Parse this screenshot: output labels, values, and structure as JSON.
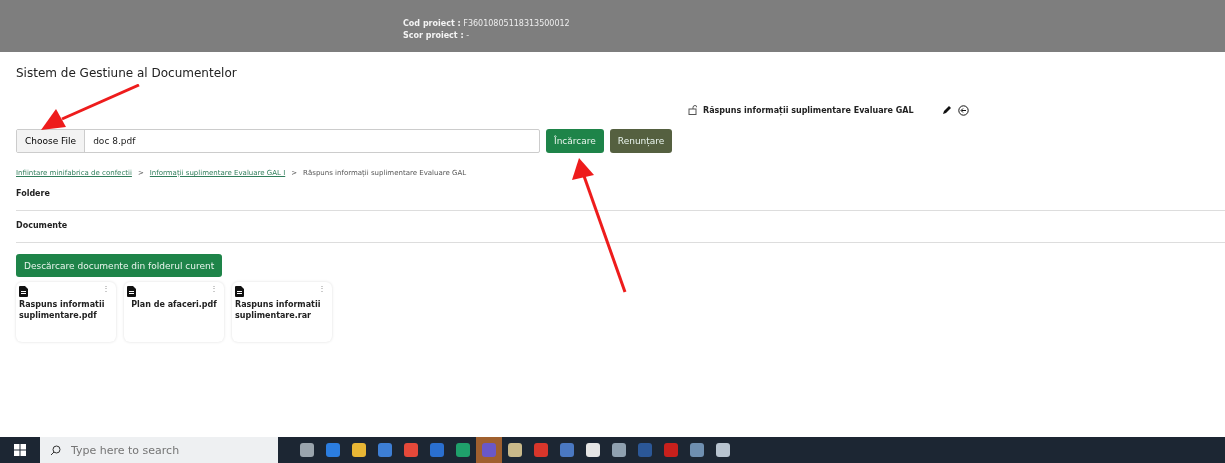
{
  "project_header": {
    "lines": [
      "**Cod proiect :** F36010805118313500012",
      "**Scor proiect :** -"
    ]
  },
  "page_title": "Sistem de Gestiune al Documentelor",
  "current_folder": {
    "title": "Răspuns informații suplimentare Evaluare GAL"
  },
  "upload": {
    "choose_button": "Choose File",
    "file_name": "doc 8.pdf",
    "upload_button": "Încărcare",
    "cancel_button": "Renunțare"
  },
  "breadcrumb": [
    {
      "label": "Infiintare minifabrica de confectii",
      "link": true
    },
    {
      "label": "Informații suplimentare Evaluare GAL I",
      "link": true
    },
    {
      "label": "Răspuns informații suplimentare Evaluare GAL",
      "link": false
    }
  ],
  "breadcrumb_separator": ">",
  "sections": [
    "Foldere",
    "Documente"
  ],
  "download_button": "Descărcare documente din folderul curent",
  "documents": [
    {
      "name": "Raspuns informatii suplimentare.pdf",
      "menu": "⋮"
    },
    {
      "name": "Plan de afaceri.pdf",
      "menu": "⋮"
    },
    {
      "name": "Raspuns informatii suplimentare.rar",
      "menu": "⋮"
    }
  ],
  "taskbar": {
    "search_placeholder": "Type here to search",
    "apps": [
      {
        "color": "#9aa4ad",
        "selected": false
      },
      {
        "color": "#2b7de0",
        "selected": false
      },
      {
        "color": "#e8b635",
        "selected": false
      },
      {
        "color": "#3d7fd6",
        "selected": false
      },
      {
        "color": "#e5493a",
        "selected": false
      },
      {
        "color": "#2a6fcf",
        "selected": false
      },
      {
        "color": "#1fa06b",
        "selected": false
      },
      {
        "color": "#6a58c8",
        "selected": true
      },
      {
        "color": "#c9b98a",
        "selected": false
      },
      {
        "color": "#d9362b",
        "selected": false
      },
      {
        "color": "#4a78c2",
        "selected": false
      },
      {
        "color": "#e6e6e6",
        "selected": false
      },
      {
        "color": "#8fa0b0",
        "selected": false
      },
      {
        "color": "#2b5797",
        "selected": false
      },
      {
        "color": "#c8201c",
        "selected": false
      },
      {
        "color": "#6f8fb0",
        "selected": false
      },
      {
        "color": "#b8c4d0",
        "selected": false
      }
    ]
  }
}
